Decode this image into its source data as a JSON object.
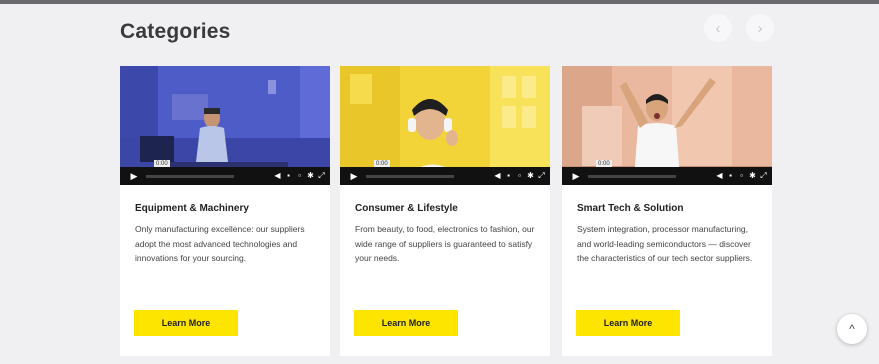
{
  "section": {
    "title": "Categories",
    "prev_icon": "chevron-left-icon",
    "next_icon": "chevron-right-icon",
    "prev_glyph": "‹",
    "next_glyph": "›"
  },
  "cards": [
    {
      "title": "Equipment & Machinery",
      "description": "Only manufacturing excellence: our suppliers adopt the most advanced technologies and innovations for your sourcing.",
      "button_label": "Learn More",
      "video_time": "0:00",
      "video_progress": 0.0
    },
    {
      "title": "Consumer & Lifestyle",
      "description": "From beauty, to food, electronics to fashion, our wide range of suppliers is guaranteed to satisfy your needs.",
      "button_label": "Learn More",
      "video_time": "0:00",
      "video_progress": 0.0
    },
    {
      "title": "Smart Tech & Solution",
      "description": "System integration, processor manufacturing, and world-leading semiconductors — discover the characteristics of our tech sector suppliers.",
      "button_label": "Learn More",
      "video_time": "0:00",
      "video_progress": 0.0
    }
  ],
  "video_controls": {
    "play_glyph": "▶",
    "icons": [
      "volume-icon",
      "captions-icon",
      "picture-in-picture-icon",
      "settings-icon",
      "fullscreen-icon"
    ]
  },
  "scroll_top": {
    "icon": "chevron-up-icon",
    "glyph": "^"
  },
  "colors": {
    "button_yellow": "#fde500",
    "background": "#f0f0f2",
    "card": "#ffffff"
  }
}
